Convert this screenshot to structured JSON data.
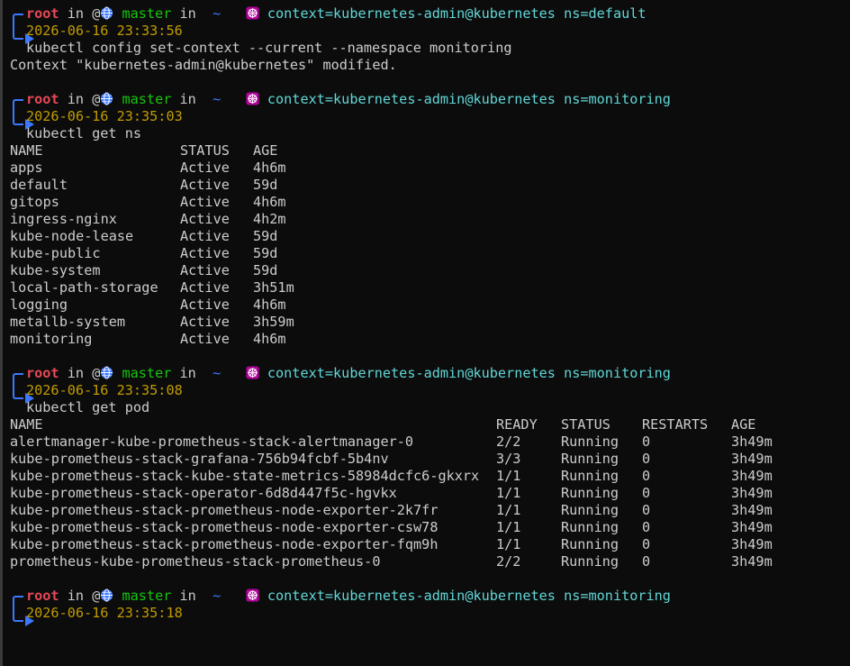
{
  "prompt_parts": {
    "user": "root",
    "in1": "in",
    "at": "@",
    "branch": "master",
    "in2": "in",
    "dir": "~",
    "context_prefix": "context=",
    "ns_prefix": "ns="
  },
  "blocks": [
    {
      "context": "kubernetes-admin@kubernetes",
      "ns": "default",
      "timestamp": "2026-06-16 23:33:56",
      "command": "kubectl config set-context --current --namespace monitoring",
      "output": "Context \"kubernetes-admin@kubernetes\" modified."
    },
    {
      "context": "kubernetes-admin@kubernetes",
      "ns": "monitoring",
      "timestamp": "2026-06-16 23:35:03",
      "command": "kubectl get ns"
    },
    {
      "context": "kubernetes-admin@kubernetes",
      "ns": "monitoring",
      "timestamp": "2026-06-16 23:35:08",
      "command": "kubectl get pod"
    },
    {
      "context": "kubernetes-admin@kubernetes",
      "ns": "monitoring",
      "timestamp": "2026-06-16 23:35:18",
      "command": ""
    }
  ],
  "ns_table": {
    "headers": [
      "NAME",
      "STATUS",
      "AGE"
    ],
    "rows": [
      [
        "apps",
        "Active",
        "4h6m"
      ],
      [
        "default",
        "Active",
        "59d"
      ],
      [
        "gitops",
        "Active",
        "4h6m"
      ],
      [
        "ingress-nginx",
        "Active",
        "4h2m"
      ],
      [
        "kube-node-lease",
        "Active",
        "59d"
      ],
      [
        "kube-public",
        "Active",
        "59d"
      ],
      [
        "kube-system",
        "Active",
        "59d"
      ],
      [
        "local-path-storage",
        "Active",
        "3h51m"
      ],
      [
        "logging",
        "Active",
        "4h6m"
      ],
      [
        "metallb-system",
        "Active",
        "3h59m"
      ],
      [
        "monitoring",
        "Active",
        "4h6m"
      ]
    ]
  },
  "pod_table": {
    "headers": [
      "NAME",
      "READY",
      "STATUS",
      "RESTARTS",
      "AGE"
    ],
    "rows": [
      [
        "alertmanager-kube-prometheus-stack-alertmanager-0",
        "2/2",
        "Running",
        "0",
        "3h49m"
      ],
      [
        "kube-prometheus-stack-grafana-756b94fcbf-5b4nv",
        "3/3",
        "Running",
        "0",
        "3h49m"
      ],
      [
        "kube-prometheus-stack-kube-state-metrics-58984dcfc6-gkxrx",
        "1/1",
        "Running",
        "0",
        "3h49m"
      ],
      [
        "kube-prometheus-stack-operator-6d8d447f5c-hgvkx",
        "1/1",
        "Running",
        "0",
        "3h49m"
      ],
      [
        "kube-prometheus-stack-prometheus-node-exporter-2k7fr",
        "1/1",
        "Running",
        "0",
        "3h49m"
      ],
      [
        "kube-prometheus-stack-prometheus-node-exporter-csw78",
        "1/1",
        "Running",
        "0",
        "3h49m"
      ],
      [
        "kube-prometheus-stack-prometheus-node-exporter-fqm9h",
        "1/1",
        "Running",
        "0",
        "3h49m"
      ],
      [
        "prometheus-kube-prometheus-stack-prometheus-0",
        "2/2",
        "Running",
        "0",
        "3h49m"
      ]
    ]
  },
  "icons": {
    "globe": "globe-icon",
    "kubernetes": "kubernetes-helm-icon",
    "prompt_arrow": "prompt-arrow-icon"
  },
  "colors": {
    "background": "#0c0c0c",
    "text": "#cccccc",
    "user": "#e74856",
    "branch": "#16c60c",
    "context": "#61d6d6",
    "timestamp": "#c19c00",
    "bracket": "#3b78ff",
    "k8s_icon": "#b4009e"
  }
}
